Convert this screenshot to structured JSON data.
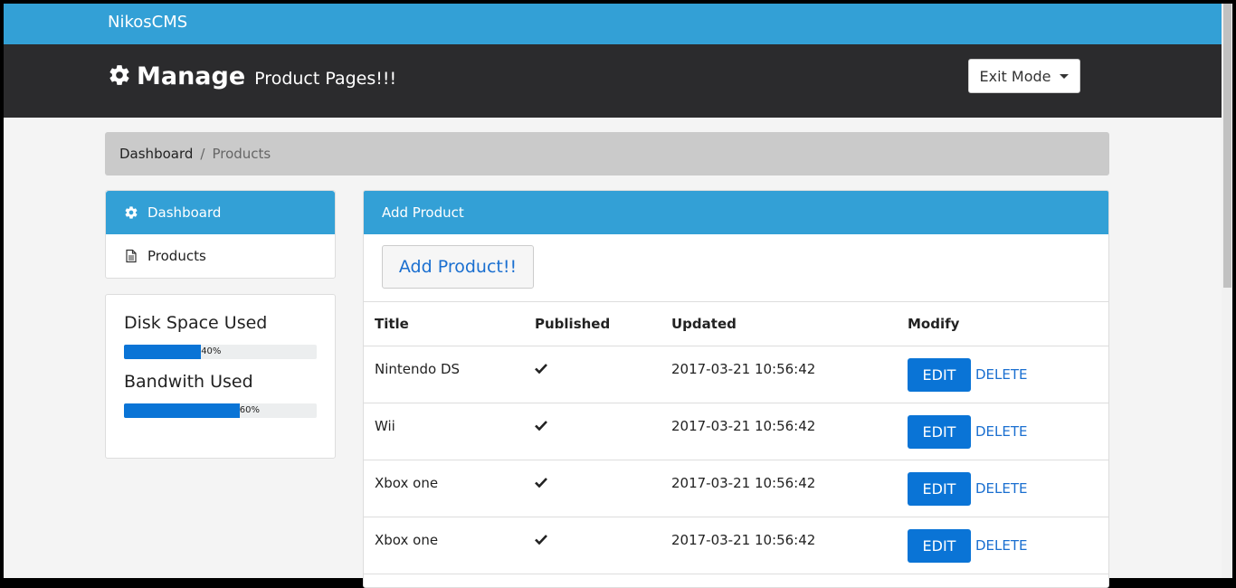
{
  "brand": "NikosCMS",
  "header": {
    "title": "Manage",
    "subtitle": "Product Pages!!!",
    "exit_label": "Exit Mode"
  },
  "breadcrumb": {
    "items": [
      "Dashboard",
      "Products"
    ],
    "separator": "/"
  },
  "sidebar": {
    "items": [
      {
        "label": "Dashboard",
        "icon": "gear-icon",
        "active": true
      },
      {
        "label": "Products",
        "icon": "document-icon",
        "active": false
      }
    ]
  },
  "stats": {
    "disk": {
      "label": "Disk Space Used",
      "percent": 40,
      "percent_label": "40%"
    },
    "bandwidth": {
      "label": "Bandwith Used",
      "percent": 60,
      "percent_label": "60%"
    }
  },
  "panel": {
    "heading": "Add Product",
    "add_button": "Add Product!!",
    "columns": [
      "Title",
      "Published",
      "Updated",
      "Modify"
    ],
    "rows": [
      {
        "title": "Nintendo DS",
        "updated": "2017-03-21 10:56:42",
        "edit": "EDIT",
        "delete": "DELETE"
      },
      {
        "title": "Wii",
        "updated": "2017-03-21 10:56:42",
        "edit": "EDIT",
        "delete": "DELETE"
      },
      {
        "title": "Xbox one",
        "updated": "2017-03-21 10:56:42",
        "edit": "EDIT",
        "delete": "DELETE"
      },
      {
        "title": "Xbox one",
        "updated": "2017-03-21 10:56:42",
        "edit": "EDIT",
        "delete": "DELETE"
      }
    ]
  },
  "colors": {
    "primary": "#33a0d6",
    "header_bg": "#2b2b2d",
    "button_blue": "#0a74d6",
    "link_blue": "#1a6fd0"
  }
}
